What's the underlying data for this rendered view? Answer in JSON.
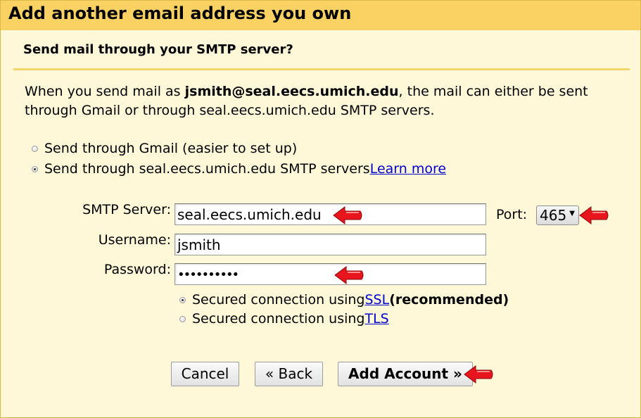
{
  "dialog": {
    "title": "Add another email address you own",
    "section_heading": "Send mail through your SMTP server?"
  },
  "description": {
    "line1_prefix": "When you send mail as ",
    "email": "jsmith@seal.eecs.umich.edu",
    "line1_suffix": ", the mail can either be sent",
    "line2": "through Gmail or through seal.eecs.umich.edu SMTP servers."
  },
  "send_options": [
    {
      "label": "Send through Gmail (easier to set up)",
      "checked": false
    },
    {
      "label": "Send through seal.eecs.umich.edu SMTP servers ",
      "link": "Learn more",
      "checked": true
    }
  ],
  "form": {
    "smtp_server": {
      "label": "SMTP Server:",
      "value": "seal.eecs.umich.edu"
    },
    "port": {
      "label": "Port:",
      "selected": "465"
    },
    "username": {
      "label": "Username:",
      "value": "jsmith"
    },
    "password": {
      "label": "Password:",
      "value": "••••••••••"
    }
  },
  "security_options": [
    {
      "prefix": "Secured connection using ",
      "link": "SSL",
      "suffix": " (recommended)",
      "checked": true
    },
    {
      "prefix": "Secured connection using ",
      "link": "TLS",
      "suffix": "",
      "checked": false
    }
  ],
  "buttons": {
    "cancel": "Cancel",
    "back": "« Back",
    "add_account": "Add Account »"
  },
  "colors": {
    "title_bar": "#fad163",
    "background": "#fff8d8",
    "link": "#0000cc",
    "annotation_arrow": "#e8141e"
  },
  "annotations": [
    "red-arrow-icon",
    "red-arrow-icon",
    "red-arrow-icon",
    "red-arrow-icon"
  ]
}
